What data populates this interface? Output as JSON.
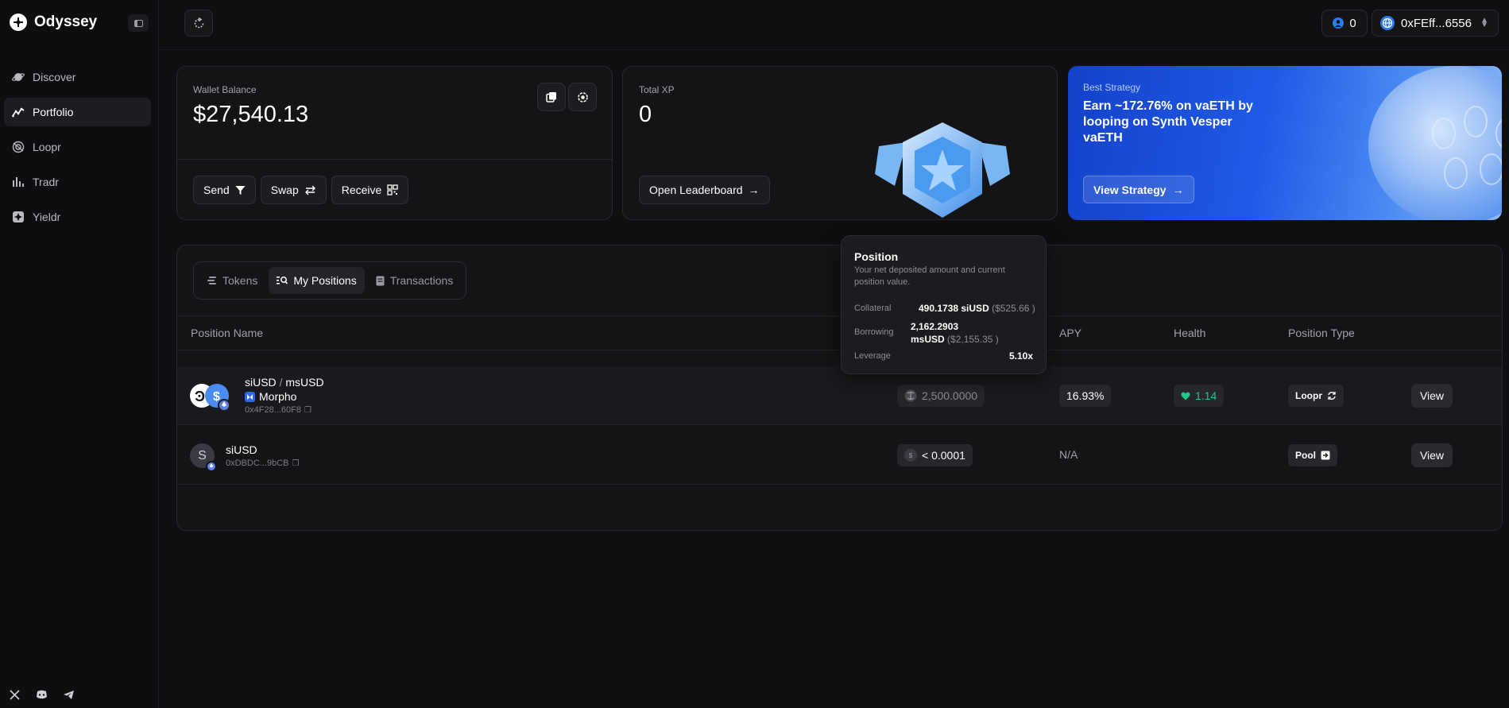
{
  "app": {
    "name": "Odyssey"
  },
  "sidebar": {
    "items": [
      {
        "label": "Discover",
        "icon": "planet-icon"
      },
      {
        "label": "Portfolio",
        "icon": "trend-icon"
      },
      {
        "label": "Loopr",
        "icon": "loop-icon"
      },
      {
        "label": "Tradr",
        "icon": "bars-icon"
      },
      {
        "label": "Yieldr",
        "icon": "yield-icon"
      }
    ],
    "active": "Portfolio"
  },
  "header": {
    "xp_count": "0",
    "wallet": "0xFEff...6556"
  },
  "wallet_card": {
    "label": "Wallet Balance",
    "balance": "$27,540.13",
    "send": "Send",
    "swap": "Swap",
    "receive": "Receive"
  },
  "xp_card": {
    "label": "Total XP",
    "value": "0",
    "button": "Open Leaderboard"
  },
  "strategy_card": {
    "label": "Best Strategy",
    "title": "Earn ~172.76% on vaETH by looping on Synth Vesper vaETH",
    "button": "View Strategy"
  },
  "tabs": [
    "Tokens",
    "My Positions",
    "Transactions"
  ],
  "active_tab": "My Positions",
  "table": {
    "columns": [
      "Position Name",
      "APY",
      "Health",
      "Position Type"
    ],
    "rows": [
      {
        "name_a": "siUSD",
        "sep": "/",
        "name_b": "msUSD",
        "protocol": "Morpho",
        "address": "0x4F28...60F8",
        "value": "2,500.0000",
        "apy": "16.93%",
        "health": "1.14",
        "type": "Loopr",
        "action": "View"
      },
      {
        "name": "siUSD",
        "avatar": "S",
        "address": "0xDBDC...9bCB",
        "value": "< 0.0001",
        "value_prefix": "$",
        "apy": "N/A",
        "type": "Pool",
        "action": "View"
      }
    ]
  },
  "tooltip": {
    "title": "Position",
    "description": "Your net deposited amount and current position value.",
    "collateral_label": "Collateral",
    "collateral_value": "490.1738 siUSD",
    "collateral_usd": "($525.66 )",
    "borrowing_label": "Borrowing",
    "borrowing_value_line1": "2,162.2903",
    "borrowing_value_line2": "msUSD",
    "borrowing_usd": "($2,155.35 )",
    "leverage_label": "Leverage",
    "leverage_value": "5.10x"
  },
  "colors": {
    "accent": "#1f5ae6",
    "health": "#22c58b",
    "background": "#0f0f11"
  }
}
